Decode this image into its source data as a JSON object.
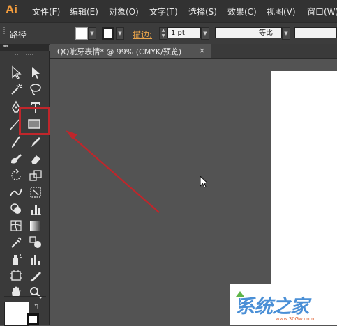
{
  "app": {
    "logo": "Ai"
  },
  "menus": [
    "文件(F)",
    "编辑(E)",
    "对象(O)",
    "文字(T)",
    "选择(S)",
    "效果(C)",
    "视图(V)",
    "窗口(W)"
  ],
  "control_bar": {
    "selection_label": "路径",
    "stroke_label": "描边:",
    "stroke_weight": "1 pt",
    "profile_label": "等比"
  },
  "tools_panel": {
    "collapse_glyph": "◂◂"
  },
  "document": {
    "tab_title": "QQ呲牙表情* @ 99% (CMYK/预览)",
    "close_glyph": "×"
  },
  "watermark": {
    "text": "系统之家",
    "url": "www.30Gw.com"
  },
  "colors": {
    "accent_stroke_label": "#e8a34a",
    "highlight_red": "#c0262b",
    "arrow_red": "#c0262b",
    "logo_orange": "#f39c3c",
    "watermark_blue": "#4a8fd6"
  }
}
